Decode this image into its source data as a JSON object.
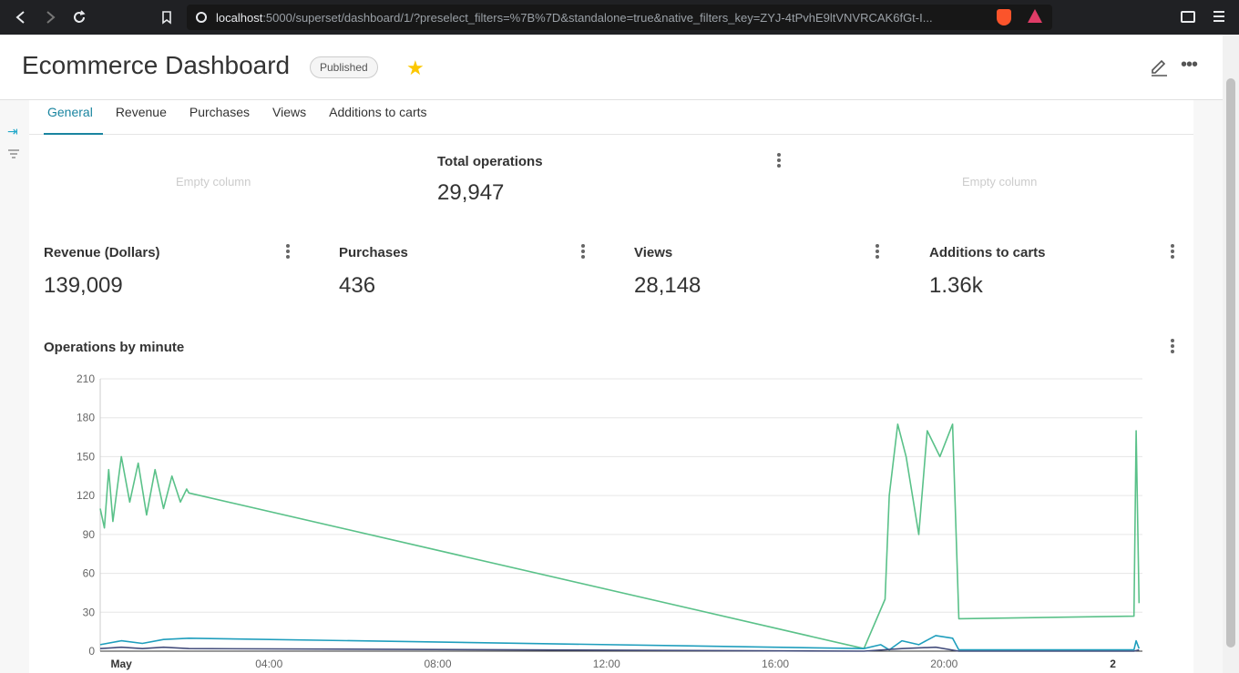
{
  "browser": {
    "url_host": "localhost",
    "url_rest": ":5000/superset/dashboard/1/?preselect_filters=%7B%7D&standalone=true&native_filters_key=ZYJ-4tPvhE9ltVNVRCAK6fGt-I..."
  },
  "header": {
    "title": "Ecommerce Dashboard",
    "badge": "Published"
  },
  "tabs": [
    "General",
    "Revenue",
    "Purchases",
    "Views",
    "Additions to carts"
  ],
  "empty_column_label": "Empty column",
  "metrics": {
    "total": {
      "title": "Total operations",
      "value": "29,947"
    },
    "revenue": {
      "title": "Revenue (Dollars)",
      "value": "139,009"
    },
    "purchases": {
      "title": "Purchases",
      "value": "436"
    },
    "views": {
      "title": "Views",
      "value": "28,148"
    },
    "carts": {
      "title": "Additions to carts",
      "value": "1.36k"
    }
  },
  "operations_chart": {
    "title": "Operations by minute"
  },
  "chart_data": {
    "type": "line",
    "title": "Operations by minute",
    "ylim": [
      0,
      210
    ],
    "yticks": [
      0,
      30,
      60,
      90,
      120,
      150,
      180,
      210
    ],
    "xtick_labels": [
      "May",
      "04:00",
      "08:00",
      "12:00",
      "16:00",
      "20:00",
      "2"
    ],
    "xtick_hours": [
      0,
      4,
      8,
      12,
      16,
      20,
      24
    ],
    "series": [
      {
        "color": "#5ac189",
        "values": [
          [
            0,
            110
          ],
          [
            0.1,
            95
          ],
          [
            0.2,
            140
          ],
          [
            0.3,
            100
          ],
          [
            0.5,
            150
          ],
          [
            0.7,
            115
          ],
          [
            0.9,
            145
          ],
          [
            1.1,
            105
          ],
          [
            1.3,
            140
          ],
          [
            1.5,
            110
          ],
          [
            1.7,
            135
          ],
          [
            1.9,
            115
          ],
          [
            2.05,
            125
          ],
          [
            2.1,
            122
          ],
          [
            18.1,
            2
          ],
          [
            18.6,
            40
          ],
          [
            18.7,
            120
          ],
          [
            18.9,
            175
          ],
          [
            19.1,
            150
          ],
          [
            19.4,
            90
          ],
          [
            19.6,
            170
          ],
          [
            19.9,
            150
          ],
          [
            20.2,
            175
          ],
          [
            20.35,
            25
          ],
          [
            24.5,
            27
          ],
          [
            24.55,
            170
          ],
          [
            24.62,
            37
          ]
        ]
      },
      {
        "color": "#1f9ebd",
        "values": [
          [
            0,
            5
          ],
          [
            0.5,
            8
          ],
          [
            1.0,
            6
          ],
          [
            1.5,
            9
          ],
          [
            2.1,
            10
          ],
          [
            18.1,
            2
          ],
          [
            18.5,
            5
          ],
          [
            18.7,
            1
          ],
          [
            19.0,
            8
          ],
          [
            19.4,
            5
          ],
          [
            19.8,
            12
          ],
          [
            20.2,
            10
          ],
          [
            20.35,
            1
          ],
          [
            24.5,
            1
          ],
          [
            24.55,
            8
          ],
          [
            24.62,
            2
          ]
        ]
      },
      {
        "color": "#454e7c",
        "values": [
          [
            0,
            2
          ],
          [
            0.5,
            3
          ],
          [
            1.0,
            2
          ],
          [
            1.5,
            3
          ],
          [
            2.1,
            2
          ],
          [
            18.1,
            0
          ],
          [
            19.0,
            2
          ],
          [
            19.8,
            3
          ],
          [
            20.35,
            0
          ],
          [
            24.5,
            0
          ],
          [
            24.62,
            1
          ]
        ]
      }
    ]
  }
}
